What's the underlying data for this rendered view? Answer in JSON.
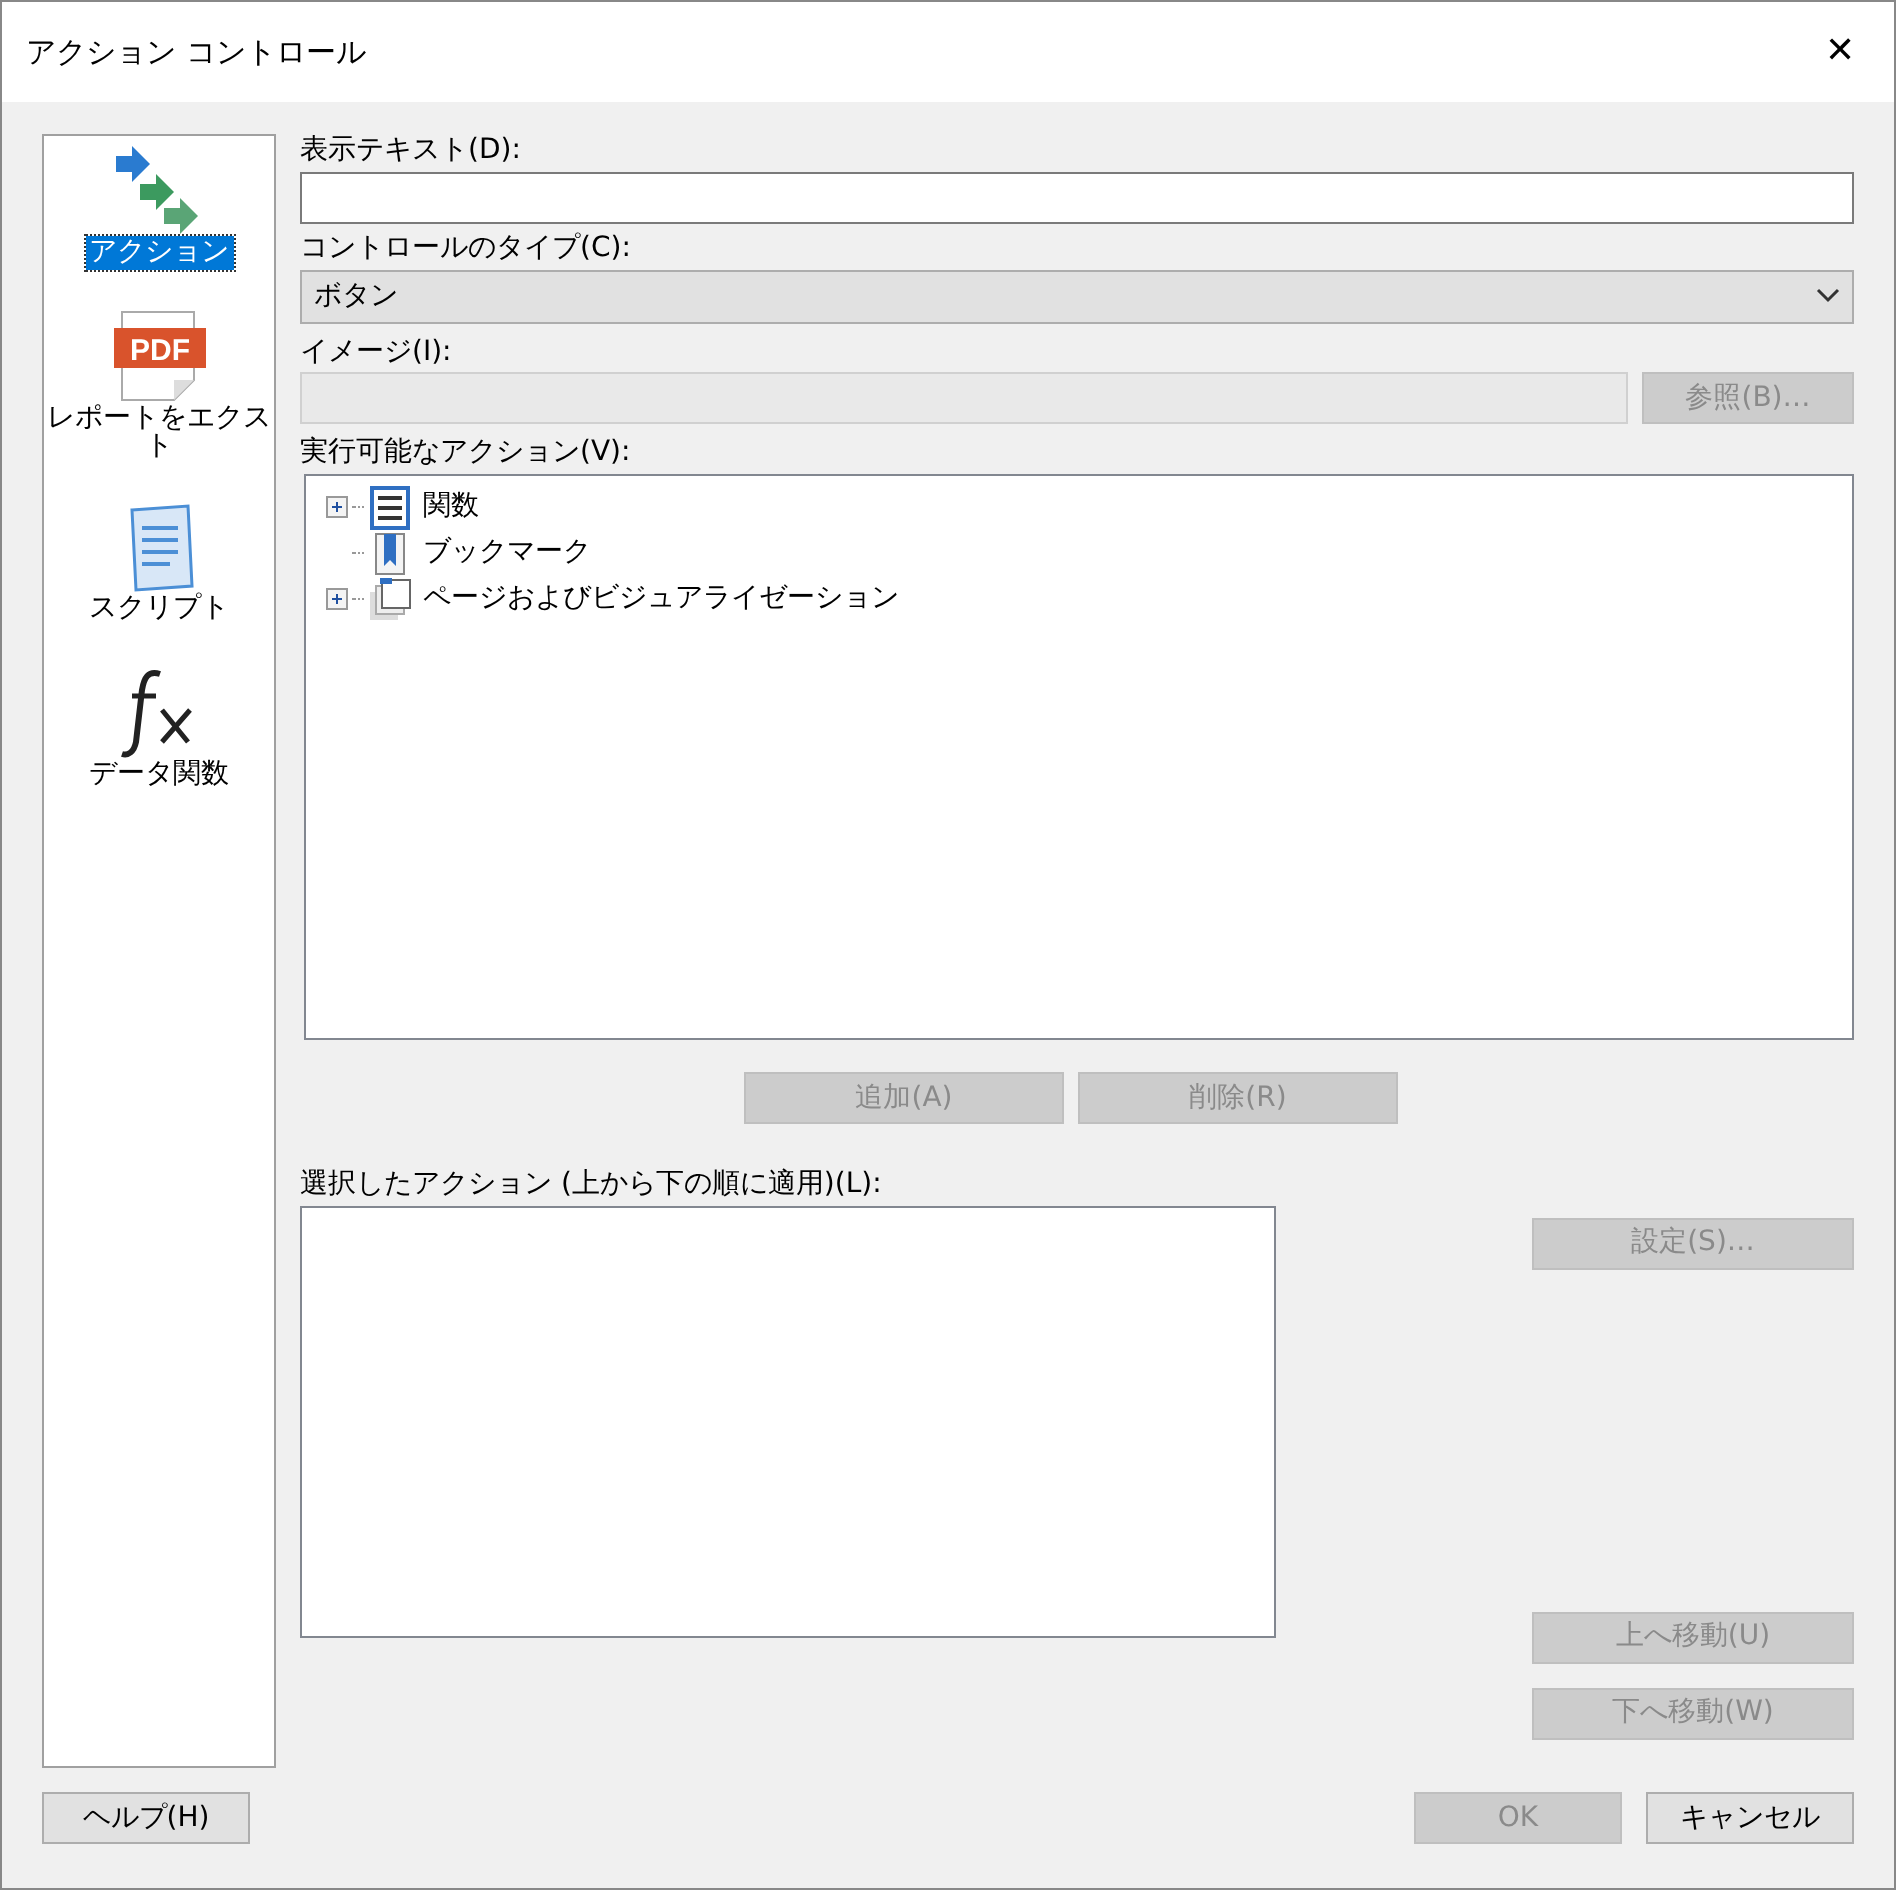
{
  "window": {
    "title": "アクション コントロール",
    "close": "✕"
  },
  "sidebar": {
    "items": [
      {
        "kind": "arrows",
        "lines": [
          "アクション"
        ],
        "selected": true
      },
      {
        "kind": "pdf",
        "icon_text": "PDF",
        "lines": [
          "レポートをエクス",
          "ト"
        ],
        "selected": false
      },
      {
        "kind": "script",
        "lines": [
          "スクリプト"
        ],
        "selected": false
      },
      {
        "kind": "fx",
        "lines": [
          "データ関数"
        ],
        "selected": false
      }
    ]
  },
  "display_text": {
    "label": "表示テキスト(D):"
  },
  "control_type": {
    "label": "コントロールのタイプ(C):",
    "value": "ボタン"
  },
  "image": {
    "label": "イメージ(I):",
    "disabled": true,
    "browse_button": {
      "label": "参照(B)…",
      "disabled": true
    }
  },
  "available_actions": {
    "label": "実行可能なアクション(V):",
    "items": [
      {
        "label": "関数",
        "kind": "function",
        "expandable": true
      },
      {
        "label": "ブックマーク",
        "kind": "bookmark",
        "expandable": false
      },
      {
        "label": "ページおよびビジュアライゼーション",
        "kind": "pages",
        "expandable": true
      }
    ]
  },
  "add_button": {
    "label": "追加(A)",
    "disabled": true
  },
  "remove_button": {
    "label": "削除(R)",
    "disabled": true
  },
  "selected_actions": {
    "label": "選択したアクション (上から下の順に適用)(L):"
  },
  "settings_button": {
    "label": "設定(S)…",
    "disabled": true
  },
  "move_up_button": {
    "label": "上へ移動(U)",
    "disabled": true
  },
  "move_down_button": {
    "label": "下へ移動(W)",
    "disabled": true
  },
  "help_button": {
    "label": "ヘルプ(H)",
    "disabled": false
  },
  "ok_button": {
    "label": "OK",
    "disabled": true
  },
  "cancel_button": {
    "label": "キャンセル",
    "disabled": false
  }
}
